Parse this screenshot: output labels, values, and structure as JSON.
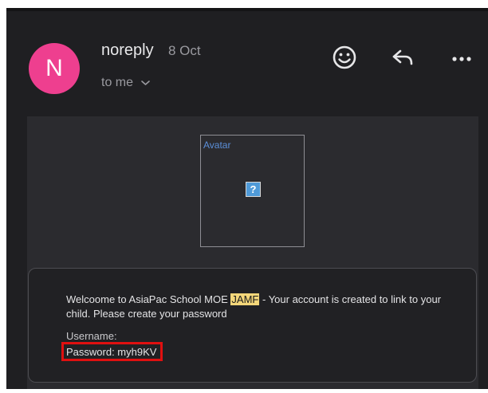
{
  "email": {
    "avatar_letter": "N",
    "sender": "noreply",
    "date": "8 Oct",
    "recipient": "to me",
    "image_alt": "Avatar",
    "broken_image_glyph": "?",
    "body_before_highlight": "Welcoome to AsiaPac School MOE ",
    "highlight": "JAMF",
    "body_after_highlight": " - Your account is created to link to your child. Please create your password",
    "username_label": "Username:",
    "password_line": "Password: myh9KV"
  },
  "icons": {
    "emoji": "smiley-icon",
    "reply": "reply-icon",
    "more": "more-icon",
    "recipient_toggle": "chevron-down-icon"
  },
  "colors": {
    "background": "#1f1f22",
    "avatar": "#ee3f8f",
    "highlight": "#f4d77a",
    "annotation": "#e01010"
  }
}
